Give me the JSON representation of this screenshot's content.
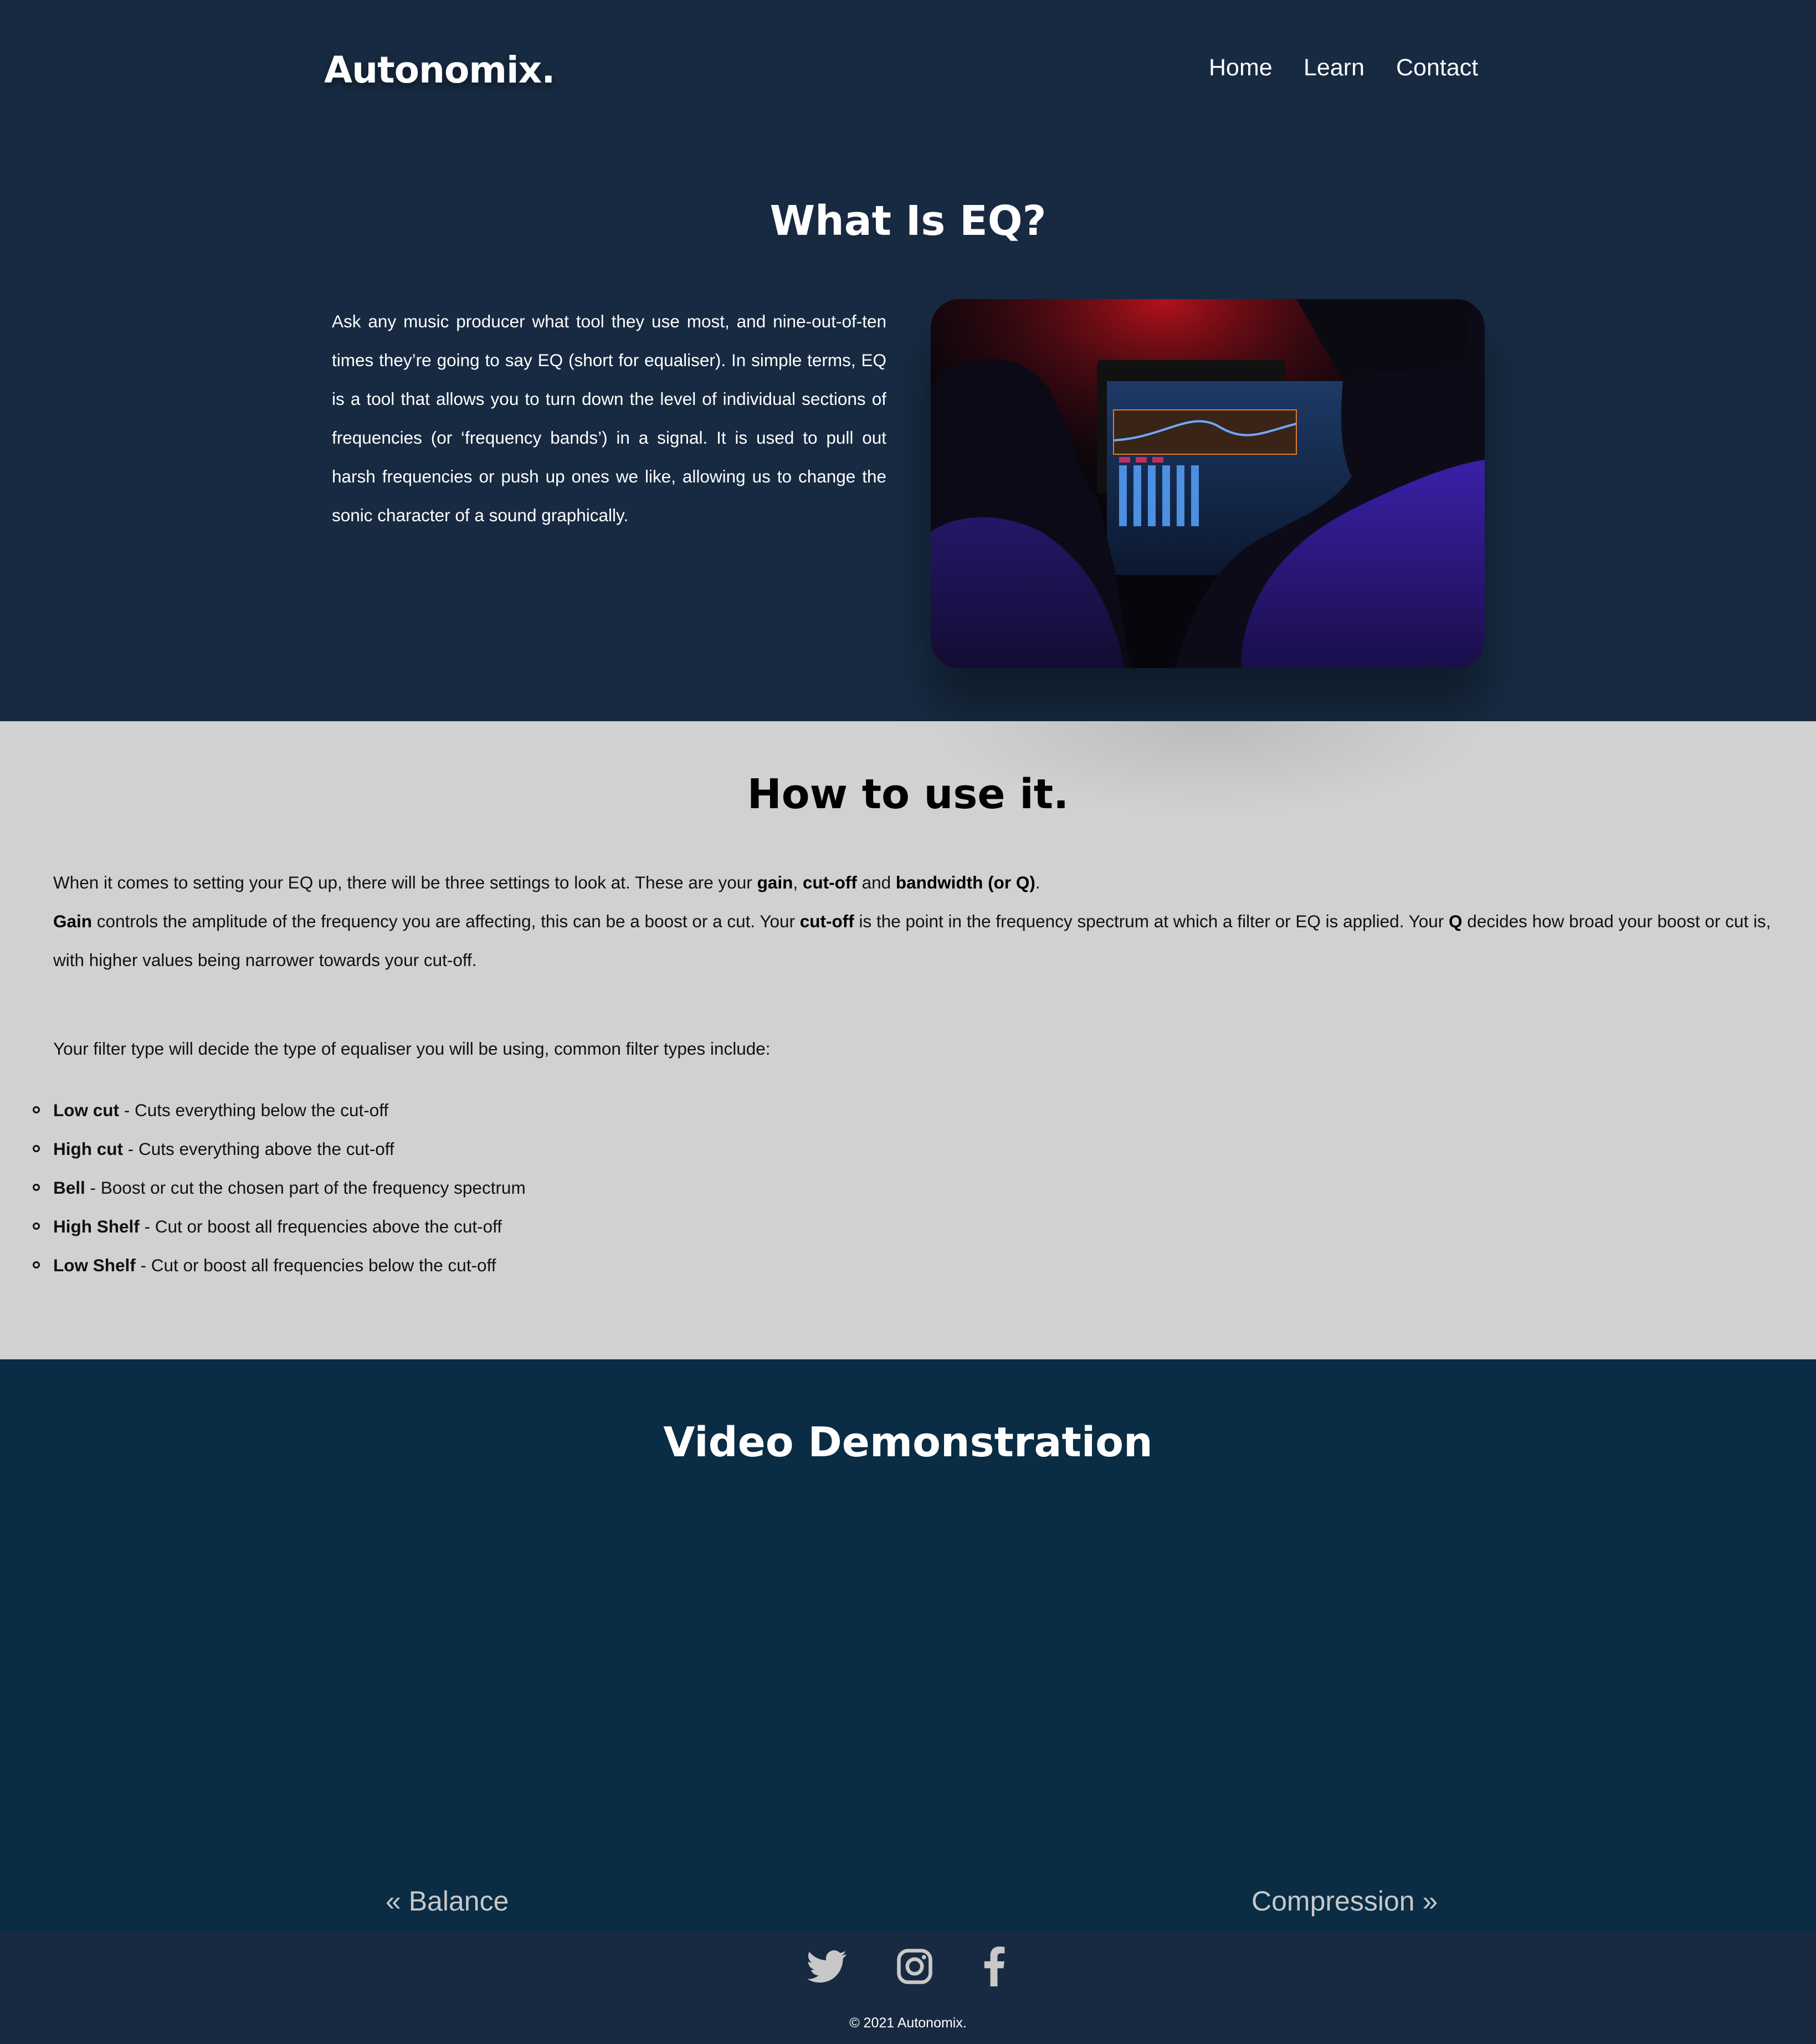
{
  "header": {
    "logo": "Autonomix.",
    "nav": [
      {
        "label": "Home"
      },
      {
        "label": "Learn"
      },
      {
        "label": "Contact"
      }
    ]
  },
  "intro": {
    "title": "What Is EQ?",
    "body": "Ask any music producer what tool they use most, and nine-out-of-ten times they’re going to say EQ (short for equaliser). In simple terms, EQ is a tool that allows you to turn down the level of individual sections of frequencies (or ‘frequency bands’) in a signal. It is used to pull out harsh frequencies or push up ones we like, allowing us to change the sonic character of a sound graphically."
  },
  "how": {
    "title": "How to use it.",
    "p1": {
      "before": "When it comes to setting your EQ up, there will be three settings to look at. These are your ",
      "b1": "gain",
      "sep1": ", ",
      "b2": "cut-off",
      "sep2": " and ",
      "b3": "bandwidth (or Q)",
      "after": "."
    },
    "p2": {
      "b1": "Gain",
      "t1": " controls the amplitude of the frequency you are affecting, this can be a boost or a cut. Your ",
      "b2": "cut-off",
      "t2": " is the point in the frequency spectrum at which a filter or EQ is applied. Your ",
      "b3": "Q",
      "t3": " decides how broad your boost or cut is, with higher values being narrower towards your cut-off."
    },
    "p3": "Your filter type will decide the type of equaliser you will be using, common filter types include:",
    "filters": [
      {
        "name": "Low cut",
        "desc": " - Cuts everything below the cut-off"
      },
      {
        "name": "High cut",
        "desc": " - Cuts everything above the cut-off"
      },
      {
        "name": "Bell",
        "desc": " - Boost or cut the chosen part of the frequency spectrum"
      },
      {
        "name": "High Shelf",
        "desc": " - Cut or boost all frequencies above the cut-off"
      },
      {
        "name": "Low Shelf",
        "desc": " - Cut or boost all frequencies below the cut-off"
      }
    ]
  },
  "video": {
    "title": "Video Demonstration",
    "prev": "« Balance",
    "next": "Compression »"
  },
  "footer": {
    "social": [
      "twitter-icon",
      "instagram-icon",
      "facebook-icon"
    ],
    "copyright": "© 2021 Autonomix."
  },
  "colors": {
    "header_bg": "#172a41",
    "section_bg": "#d1d1d1",
    "video_bg": "#0a2c44"
  }
}
